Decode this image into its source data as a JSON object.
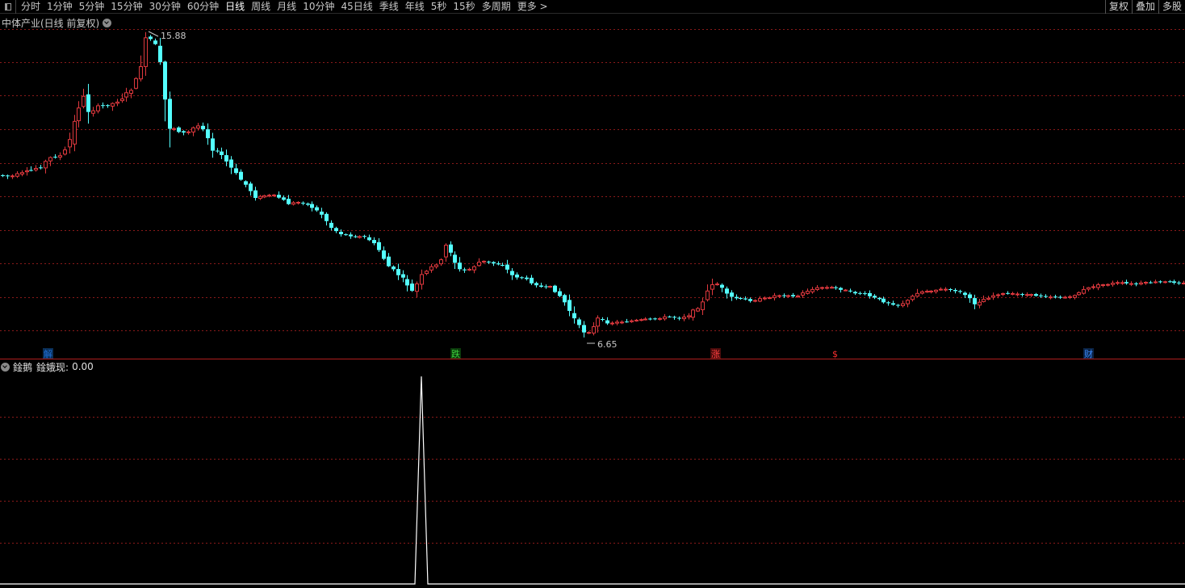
{
  "toolbar": {
    "periods": [
      "分时",
      "1分钟",
      "5分钟",
      "15分钟",
      "30分钟",
      "60分钟",
      "日线",
      "周线",
      "月线",
      "10分钟",
      "45日线",
      "季线",
      "年线",
      "5秒",
      "15秒",
      "多周期",
      "更多 >"
    ],
    "active_period": "日线",
    "right_buttons": [
      "复权",
      "叠加",
      "多股"
    ]
  },
  "main_chart": {
    "title": "中体产业(日线 前复权)",
    "high_label": "15.88",
    "low_label": "6.65",
    "up_color": "#e0393e",
    "down_color": "#54ffff",
    "grid_color": "#8a1a1a",
    "event_markers": [
      {
        "label": "解",
        "color": "#1e6fd9",
        "bg": "#0a2f58"
      },
      {
        "label": "跌",
        "color": "#3cd23c",
        "bg": "#0b3a0b"
      },
      {
        "label": "涨",
        "color": "#ff4040",
        "bg": "#4a0b0b"
      },
      {
        "label": "$",
        "color": "#ff3030",
        "bg": "#000000"
      },
      {
        "label": "财",
        "color": "#3c8cff",
        "bg": "#0a2346"
      }
    ]
  },
  "sub_chart": {
    "name": "鍂鹅",
    "value_label": "鍂娥现:",
    "value": "0.00",
    "line_color": "#ffffff"
  }
}
